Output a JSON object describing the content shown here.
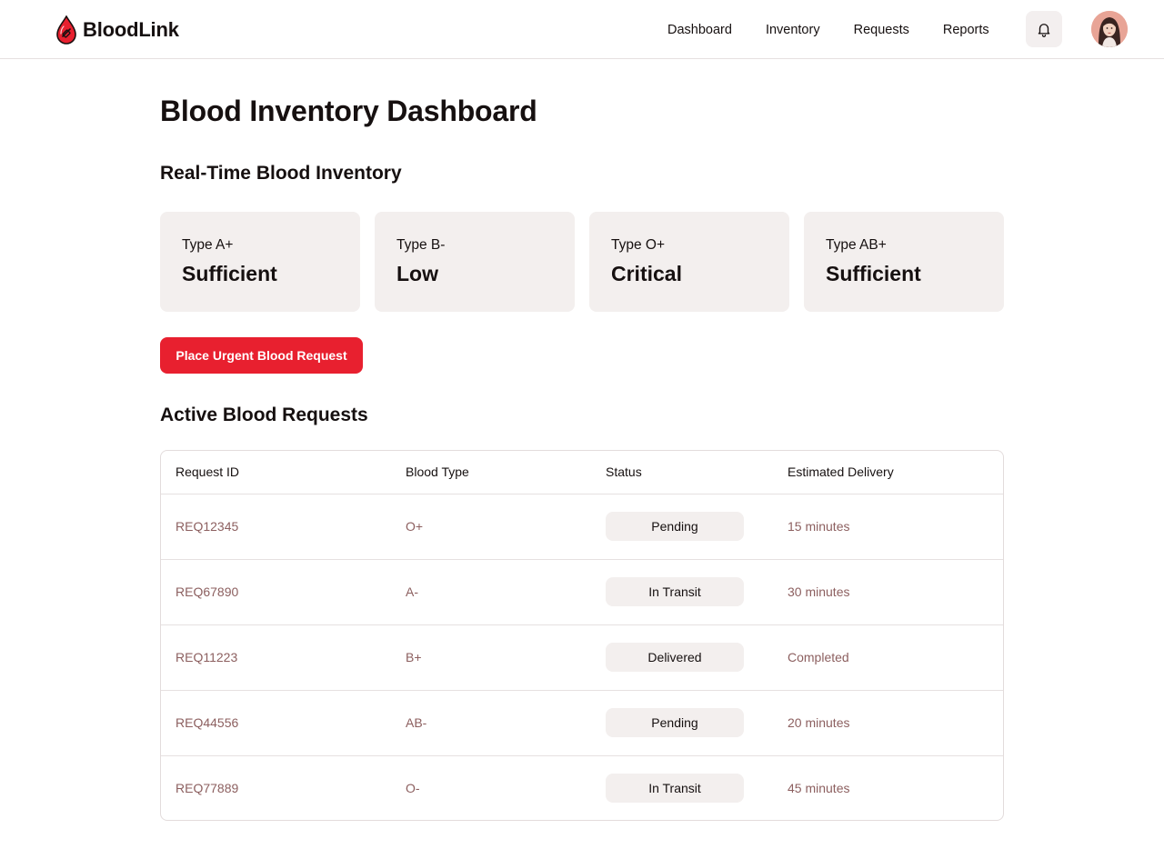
{
  "header": {
    "brand": "BloodLink",
    "nav": [
      "Dashboard",
      "Inventory",
      "Requests",
      "Reports"
    ]
  },
  "page": {
    "title": "Blood Inventory Dashboard"
  },
  "inventory": {
    "title": "Real-Time Blood Inventory",
    "cards": [
      {
        "type": "Type A+",
        "status": "Sufficient"
      },
      {
        "type": "Type B-",
        "status": "Low"
      },
      {
        "type": "Type O+",
        "status": "Critical"
      },
      {
        "type": "Type AB+",
        "status": "Sufficient"
      }
    ]
  },
  "urgent_button": "Place Urgent Blood Request",
  "requests": {
    "title": "Active Blood Requests",
    "columns": [
      "Request ID",
      "Blood Type",
      "Status",
      "Estimated Delivery"
    ],
    "rows": [
      {
        "id": "REQ12345",
        "blood_type": "O+",
        "status": "Pending",
        "delivery": "15 minutes"
      },
      {
        "id": "REQ67890",
        "blood_type": "A-",
        "status": "In Transit",
        "delivery": "30 minutes"
      },
      {
        "id": "REQ11223",
        "blood_type": "B+",
        "status": "Delivered",
        "delivery": "Completed"
      },
      {
        "id": "REQ44556",
        "blood_type": "AB-",
        "status": "Pending",
        "delivery": "20 minutes"
      },
      {
        "id": "REQ77889",
        "blood_type": "O-",
        "status": "In Transit",
        "delivery": "45 minutes"
      }
    ]
  },
  "icons": {
    "logo": "blood-drop-icon",
    "notifications": "bell-icon",
    "profile": "avatar"
  },
  "colors": {
    "accent": "#e8202f",
    "card_bg": "#f3efee",
    "muted_text": "#8c5f5f"
  }
}
